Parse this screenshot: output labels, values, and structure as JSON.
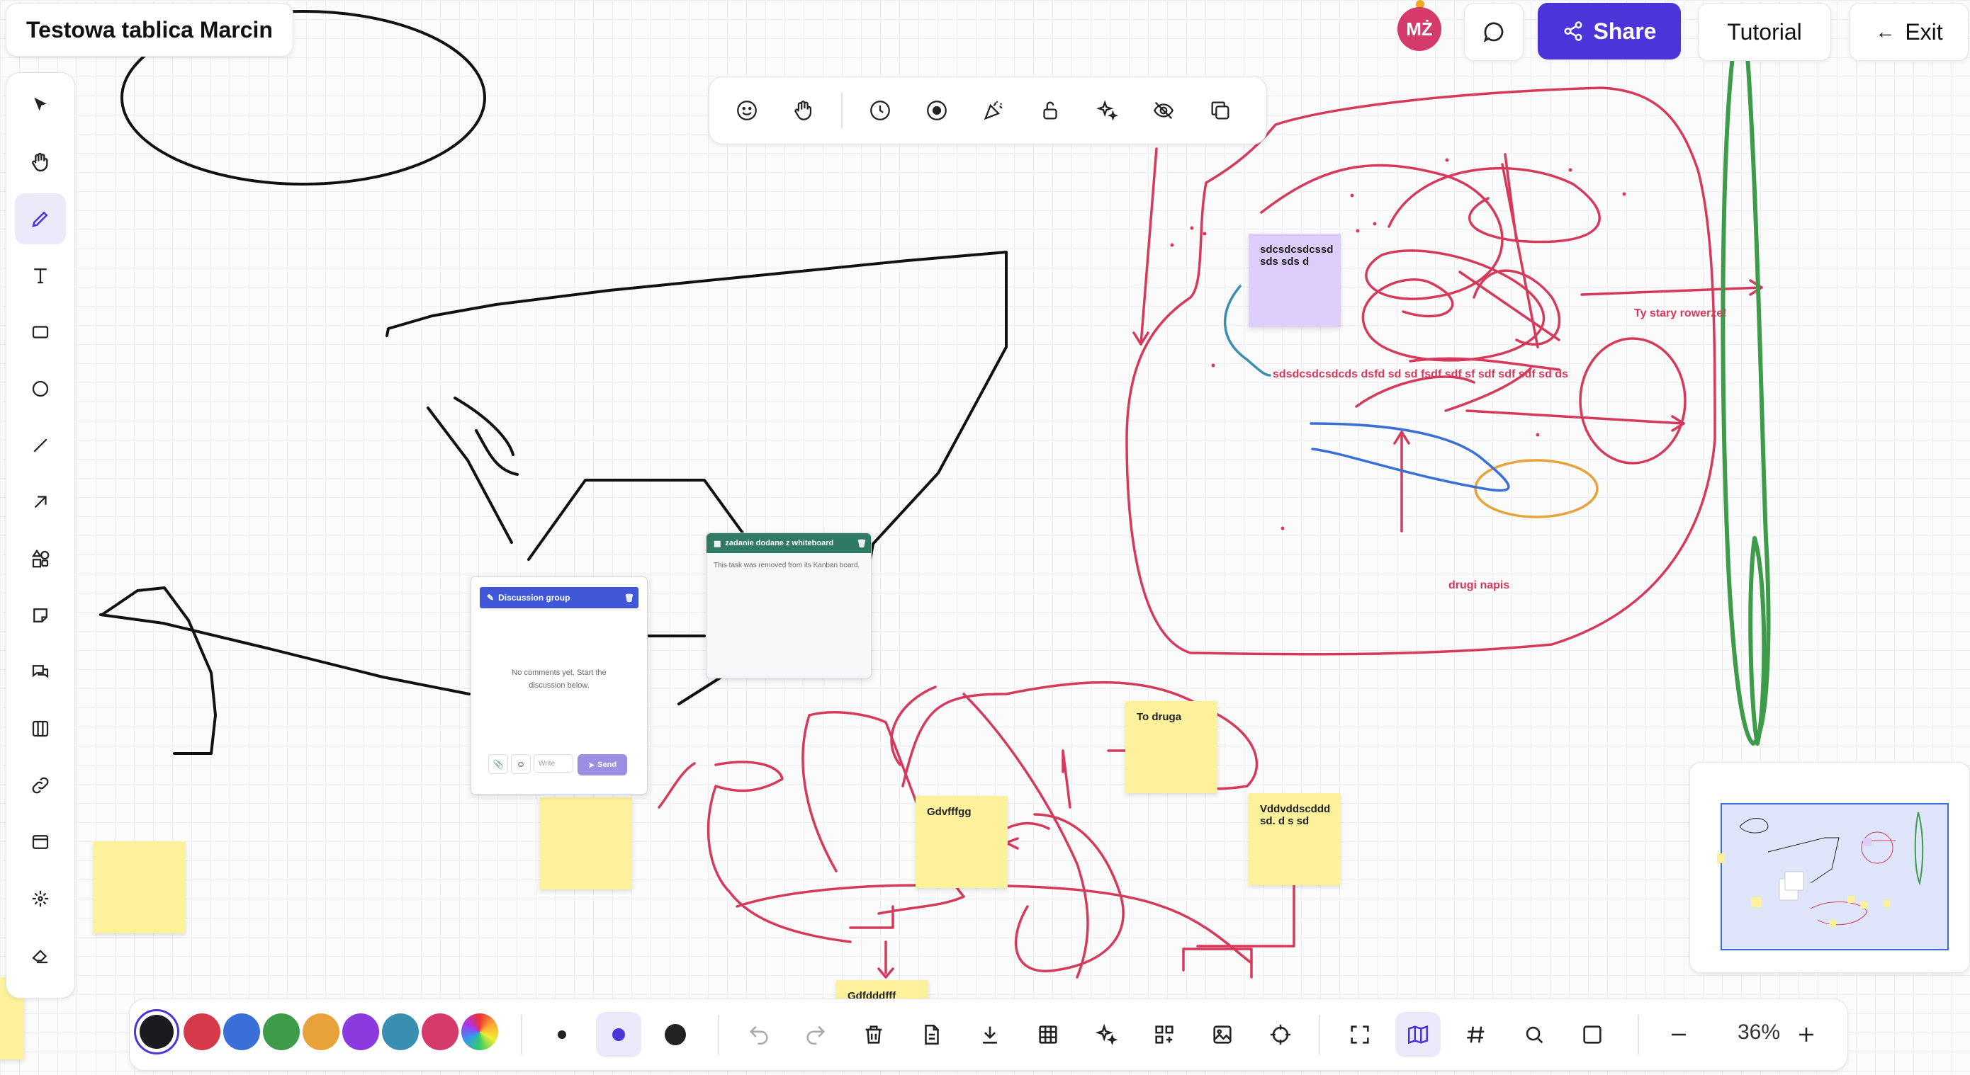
{
  "app": {
    "board_title": "Testowa tablica Marcin",
    "user_initials": "MŻ",
    "share_label": "Share",
    "tutorial_label": "Tutorial",
    "exit_label": "Exit",
    "zoom_level": "36%"
  },
  "left_toolbar": [
    {
      "name": "select-tool",
      "icon": "cursor-icon",
      "active": false
    },
    {
      "name": "hand-tool",
      "icon": "hand-icon",
      "active": false
    },
    {
      "name": "pen-tool",
      "icon": "pencil-icon",
      "active": true
    },
    {
      "name": "text-tool",
      "icon": "text-icon",
      "active": false
    },
    {
      "name": "rectangle-tool",
      "icon": "rectangle-icon",
      "active": false
    },
    {
      "name": "ellipse-tool",
      "icon": "circle-icon",
      "active": false
    },
    {
      "name": "line-tool",
      "icon": "line-icon",
      "active": false
    },
    {
      "name": "arrow-tool",
      "icon": "arrow-icon",
      "active": false
    },
    {
      "name": "shapes-tool",
      "icon": "shapes-icon",
      "active": false
    },
    {
      "name": "sticky-note-tool",
      "icon": "sticky-note-icon",
      "active": false
    },
    {
      "name": "comment-tool",
      "icon": "comments-icon",
      "active": false
    },
    {
      "name": "kanban-tool",
      "icon": "columns-icon",
      "active": false
    },
    {
      "name": "link-tool",
      "icon": "link-icon",
      "active": false
    },
    {
      "name": "frame-tool",
      "icon": "frame-icon",
      "active": false
    },
    {
      "name": "laser-tool",
      "icon": "sparkle-icon",
      "active": false
    },
    {
      "name": "eraser-tool",
      "icon": "eraser-icon",
      "active": false
    }
  ],
  "top_toolbar": [
    {
      "name": "reactions",
      "icon": "smile-icon"
    },
    {
      "name": "hand",
      "icon": "hand-icon"
    },
    {
      "name": "timer",
      "icon": "clock-icon"
    },
    {
      "name": "record",
      "icon": "record-icon"
    },
    {
      "name": "celebrate",
      "icon": "party-icon"
    },
    {
      "name": "lock",
      "icon": "unlock-icon"
    },
    {
      "name": "ai",
      "icon": "sparkles-icon"
    },
    {
      "name": "hide",
      "icon": "eye-off-icon"
    },
    {
      "name": "duplicate",
      "icon": "copy-icon"
    }
  ],
  "colors": [
    "#1b1b1f",
    "#d63a4a",
    "#3b6fd8",
    "#3e9b4a",
    "#e8a23a",
    "#8b3ae0",
    "#3a8fb0",
    "#d63a6b"
  ],
  "bottom_toolbar": [
    {
      "name": "undo",
      "icon": "undo-icon"
    },
    {
      "name": "redo",
      "icon": "redo-icon"
    },
    {
      "name": "delete",
      "icon": "trash-icon"
    },
    {
      "name": "document",
      "icon": "document-icon"
    },
    {
      "name": "download",
      "icon": "download-icon"
    },
    {
      "name": "table",
      "icon": "table-icon"
    },
    {
      "name": "ai",
      "icon": "sparkles-icon"
    },
    {
      "name": "add-widget",
      "icon": "grid-plus-icon"
    },
    {
      "name": "image",
      "icon": "image-icon"
    },
    {
      "name": "target",
      "icon": "target-icon"
    },
    {
      "name": "fullscreen",
      "icon": "fullscreen-icon"
    },
    {
      "name": "map",
      "icon": "map-icon"
    },
    {
      "name": "grid",
      "icon": "hash-icon"
    },
    {
      "name": "search",
      "icon": "search-icon"
    },
    {
      "name": "dots-grid",
      "icon": "dots-grid-icon"
    },
    {
      "name": "zoom-out",
      "icon": "minus-icon"
    },
    {
      "name": "zoom-in",
      "icon": "plus-icon"
    }
  ],
  "sticky_notes": [
    {
      "name": "note-purple",
      "text": "sdcsdcsdcssd sds sds d"
    },
    {
      "name": "note-to-druga",
      "text": "To druga"
    },
    {
      "name": "note-gdvfffgg",
      "text": "Gdvfffgg"
    },
    {
      "name": "note-vddvdd",
      "text": "Vddvddscddd sd. d s sd"
    },
    {
      "name": "note-gdfdddfff",
      "text": "Gdfdddfff"
    }
  ],
  "canvas_labels": {
    "text1": "Ty stary rowerze!",
    "text2": "sdsdcsdcsdcds dsfd sd sd fsdf sdf sf sdf sdf sdf sd ds",
    "text3": "drugi napis"
  },
  "discussion_card": {
    "title": "Discussion group",
    "empty_text_1": "No comments yet. Start the",
    "empty_text_2": "discussion below.",
    "input_placeholder": "Write",
    "send_label": "Send"
  },
  "task_card": {
    "title": "zadanie dodane z whiteboard",
    "body": "This task was removed from its Kanban board."
  }
}
